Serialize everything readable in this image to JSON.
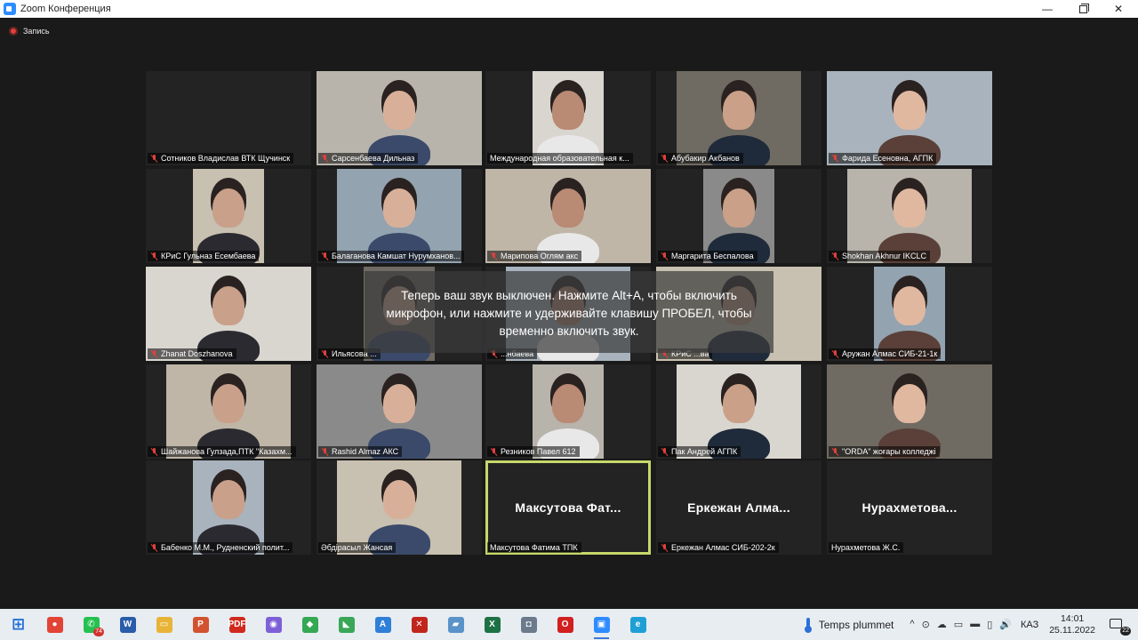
{
  "window": {
    "title": "Zoom Конференция",
    "minimize_glyph": "—",
    "close_glyph": "✕"
  },
  "recording": {
    "label": "Запись",
    "color": "#e0403c"
  },
  "notice": {
    "text": "Теперь ваш звук выключен. Нажмите Alt+A, чтобы включить микрофон, или нажмите и удерживайте клавишу ПРОБЕЛ, чтобы временно включить звук."
  },
  "colors": {
    "active_speaker_border": "#c6d86a",
    "muted_icon": "#e0403c",
    "background": "#1a1a1a"
  },
  "participants": [
    {
      "name": "Сотников Владислав ВТК Щучинск",
      "muted": true,
      "video": false
    },
    {
      "name": "Сарсенбаева Дильназ",
      "muted": true,
      "video": true
    },
    {
      "name": "Международная образовательная к...",
      "muted": false,
      "video": true
    },
    {
      "name": "Абубакир Акбанов",
      "muted": true,
      "video": true
    },
    {
      "name": "Фарида Есеновна, АГПК",
      "muted": true,
      "video": true
    },
    {
      "name": "КРиС Гульназ Есембаева",
      "muted": true,
      "video": true
    },
    {
      "name": "Балаганова Камшат Нурумханов...",
      "muted": true,
      "video": true
    },
    {
      "name": "Марипова Оглям акс",
      "muted": true,
      "video": true
    },
    {
      "name": "Маргарита Беспалова",
      "muted": true,
      "video": true
    },
    {
      "name": "Shokhan Akhnur IKCLC",
      "muted": true,
      "video": true
    },
    {
      "name": "Zhanat Doszhanova",
      "muted": true,
      "video": true
    },
    {
      "name": "Ильясова ...",
      "muted": true,
      "video": true
    },
    {
      "name": "...нбаева",
      "muted": true,
      "video": true
    },
    {
      "name": "КРиС ...ва",
      "muted": true,
      "video": true
    },
    {
      "name": "Аружан Алмас СИБ-21-1к",
      "muted": true,
      "video": true
    },
    {
      "name": "Шайжанова Гулзада,ПТК \"Казахм...",
      "muted": true,
      "video": true
    },
    {
      "name": "Rashid Almaz АКС",
      "muted": true,
      "video": true
    },
    {
      "name": "Резников Павел 612",
      "muted": true,
      "video": true
    },
    {
      "name": "Пак Андрей АГПК",
      "muted": true,
      "video": true
    },
    {
      "name": "\"ORDA\" жоғары колледжі",
      "muted": true,
      "video": true
    },
    {
      "name": "Бабенко М.М., Рудненский полит...",
      "muted": true,
      "video": true
    },
    {
      "name": "Әбдірасыл Жансая",
      "muted": false,
      "video": true
    },
    {
      "name": "Максутова Фатима ТПК",
      "muted": false,
      "video": false,
      "display_name": "Максутова  Фат...",
      "active": true
    },
    {
      "name": "Еркежан Алмас СИБ-202-2к",
      "muted": true,
      "video": false,
      "display_name": "Еркежан  Алма..."
    },
    {
      "name": "Нурахметова Ж.С.",
      "muted": false,
      "video": false,
      "display_name": "Нурахметова..."
    }
  ],
  "taskbar": {
    "apps": [
      {
        "name": "windows-start",
        "glyph": "⊞",
        "color": "#1f6fd6"
      },
      {
        "name": "chrome",
        "glyph": "●",
        "color": "#e24335"
      },
      {
        "name": "whatsapp",
        "glyph": "✆",
        "color": "#25c150",
        "badge": "74"
      },
      {
        "name": "word",
        "glyph": "W",
        "color": "#2a5caa"
      },
      {
        "name": "file-explorer",
        "glyph": "▭",
        "color": "#e8b437"
      },
      {
        "name": "powerpoint",
        "glyph": "P",
        "color": "#d35230"
      },
      {
        "name": "pdf",
        "glyph": "PDF",
        "color": "#d02a1e"
      },
      {
        "name": "app-purple",
        "glyph": "◉",
        "color": "#7d5fd6"
      },
      {
        "name": "app-green-leaf",
        "glyph": "◆",
        "color": "#34a853"
      },
      {
        "name": "app-green-bookmark",
        "glyph": "◣",
        "color": "#3aa757"
      },
      {
        "name": "app-a",
        "glyph": "A",
        "color": "#2f7fd8"
      },
      {
        "name": "pdf-tool",
        "glyph": "✕",
        "color": "#c0261c"
      },
      {
        "name": "app-blue-book",
        "glyph": "▰",
        "color": "#5a93c9"
      },
      {
        "name": "excel",
        "glyph": "X",
        "color": "#1d7145"
      },
      {
        "name": "camera",
        "glyph": "◘",
        "color": "#6b7b8c"
      },
      {
        "name": "opera",
        "glyph": "O",
        "color": "#d21f1f"
      },
      {
        "name": "zoom",
        "glyph": "▣",
        "color": "#2d8cff",
        "active": true
      },
      {
        "name": "edge",
        "glyph": "e",
        "color": "#1f9fd6"
      }
    ],
    "weather": "Temps plummet",
    "tray_icons": [
      "^",
      "⊙",
      "☁",
      "▭",
      "▬",
      "▯",
      "🔊"
    ],
    "language": "КАЗ",
    "time": "14:01",
    "date": "25.11.2022",
    "notifications": "22"
  }
}
